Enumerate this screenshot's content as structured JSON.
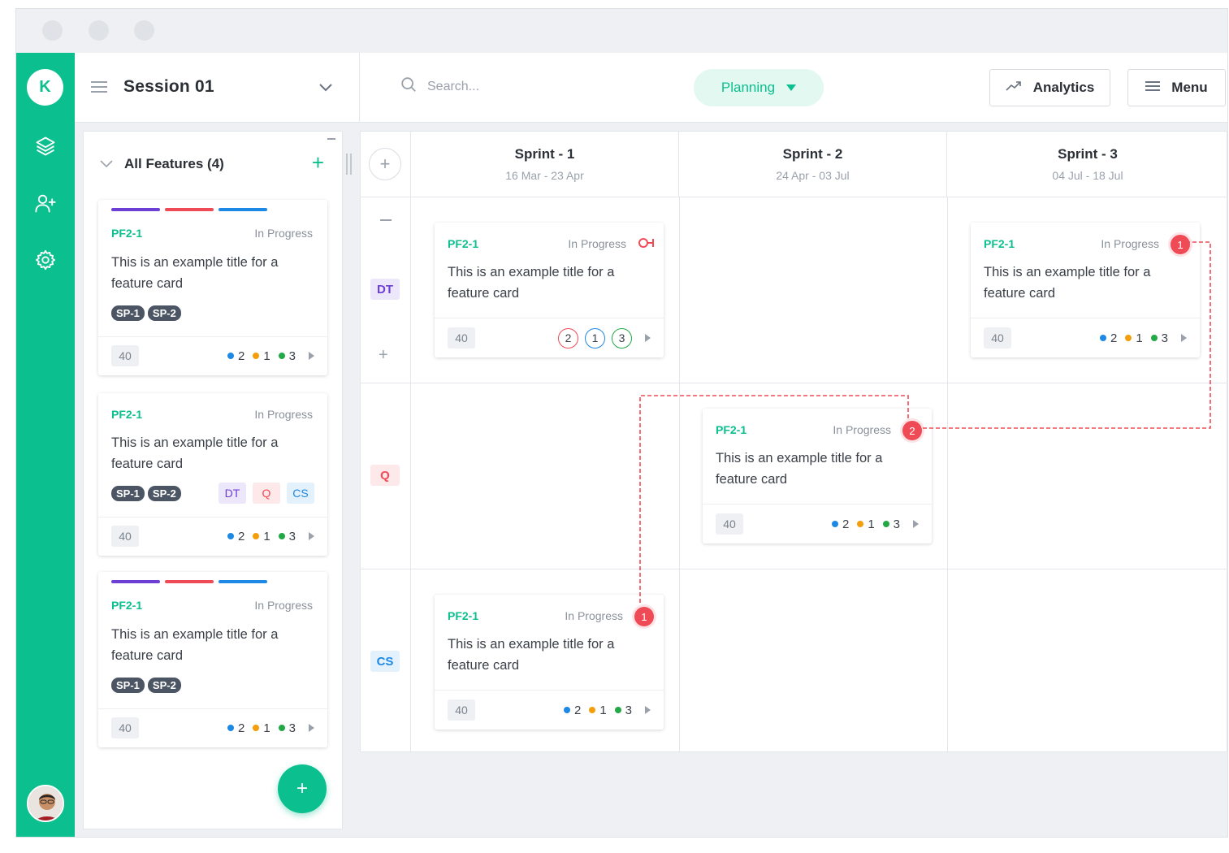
{
  "sidebar": {
    "workspace_initial": "K"
  },
  "topbar": {
    "session_title": "Session 01",
    "search_placeholder": "Search...",
    "mode_label": "Planning",
    "analytics_label": "Analytics",
    "menu_label": "Menu"
  },
  "panel": {
    "header": "All Features (4)",
    "cards": [
      {
        "id": "PF2-1",
        "status": "In Progress",
        "title": "This is an example title for a feature card",
        "tags": [
          "SP-1",
          "SP-2"
        ],
        "teams": [],
        "points": "40",
        "counts": [
          "2",
          "1",
          "3"
        ]
      },
      {
        "id": "PF2-1",
        "status": "In Progress",
        "title": "This is an example title for a feature card",
        "tags": [
          "SP-1",
          "SP-2"
        ],
        "teams": [
          "DT",
          "Q",
          "CS"
        ],
        "points": "40",
        "counts": [
          "2",
          "1",
          "3"
        ]
      },
      {
        "id": "PF2-1",
        "status": "In Progress",
        "title": "This is an example title for a feature card",
        "tags": [
          "SP-1",
          "SP-2"
        ],
        "teams": [],
        "points": "40",
        "counts": [
          "2",
          "1",
          "3"
        ]
      }
    ]
  },
  "board": {
    "sprints": [
      {
        "name": "Sprint - 1",
        "dates": "16 Mar - 23 Apr"
      },
      {
        "name": "Sprint - 2",
        "dates": "24 Apr - 03 Jul"
      },
      {
        "name": "Sprint - 3",
        "dates": "04 Jul - 18 Jul"
      }
    ],
    "rows": [
      "DT",
      "Q",
      "CS"
    ],
    "cards": [
      {
        "id": "PF2-1",
        "status": "In Progress",
        "title": "This is an example title for a feature card",
        "points": "40",
        "rings": [
          "2",
          "1",
          "3"
        ]
      },
      {
        "id": "PF2-1",
        "status": "In Progress",
        "title": "This is an example title for a feature card",
        "points": "40",
        "counts": [
          "2",
          "1",
          "3"
        ],
        "badge": "1"
      },
      {
        "id": "PF2-1",
        "status": "In Progress",
        "title": "This is an example title for a feature card",
        "points": "40",
        "counts": [
          "2",
          "1",
          "3"
        ],
        "badge": "2"
      },
      {
        "id": "PF2-1",
        "status": "In Progress",
        "title": "This is an example title for a feature card",
        "points": "40",
        "counts": [
          "2",
          "1",
          "3"
        ],
        "badge": "1"
      }
    ]
  },
  "colors": {
    "accent": "#0bbf8e",
    "danger": "#ef4b56",
    "bar_purple": "#6c3fd6",
    "bar_red": "#ef4b56",
    "bar_blue": "#1e88e5",
    "count_blue": "#1e88e5",
    "count_orange": "#f59e0b",
    "count_green": "#22a845"
  }
}
